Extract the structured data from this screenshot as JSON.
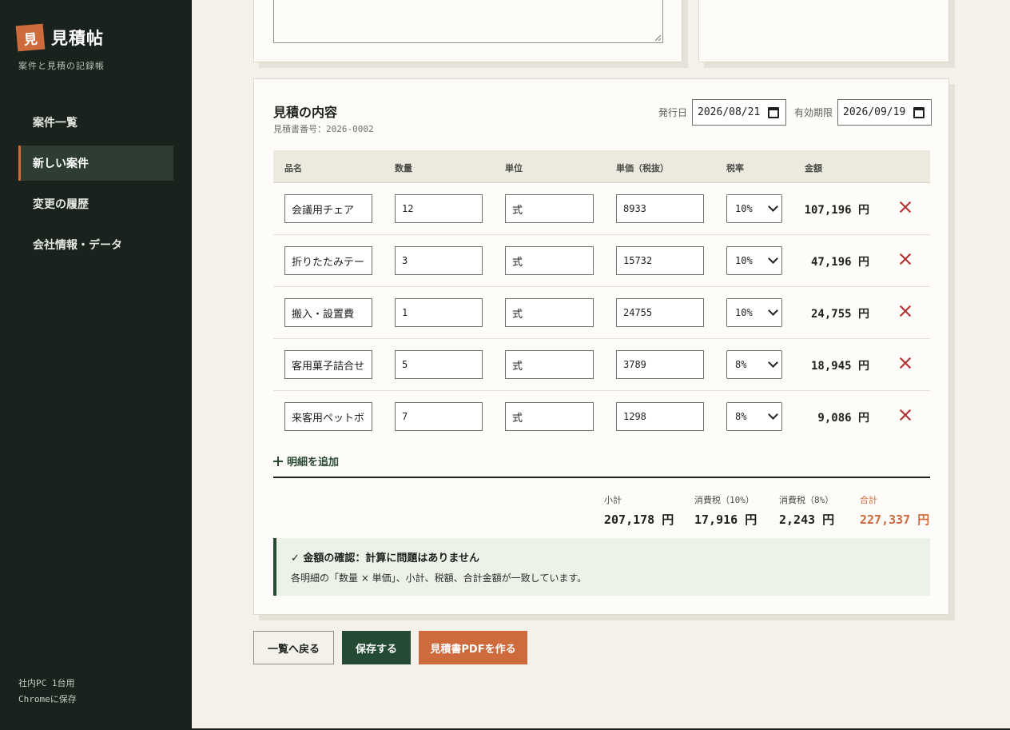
{
  "sidebar": {
    "logo_mark": "見",
    "app_name": "見積帖",
    "tagline": "案件と見積の記録帳",
    "items": [
      {
        "label": "案件一覧",
        "active": false
      },
      {
        "label": "新しい案件",
        "active": true
      },
      {
        "label": "変更の履歴",
        "active": false
      },
      {
        "label": "会社情報・データ",
        "active": false
      }
    ],
    "footer_line1": "社内PC 1台用",
    "footer_line2": "Chromeに保存"
  },
  "estimate": {
    "title": "見積の内容",
    "number_label": "見積書番号：2026-0002",
    "issue_label": "発行日",
    "issue_date": "2026/08/21",
    "expiry_label": "有効期限",
    "expiry_date": "2026/09/19",
    "columns": [
      "品名",
      "数量",
      "単位",
      "単価（税抜）",
      "税率",
      "金額"
    ],
    "rows": [
      {
        "item": "会議用チェア",
        "qty": "12",
        "unit": "式",
        "price": "8933",
        "tax": "10%",
        "amount": "107,196 円"
      },
      {
        "item": "折りたたみテー",
        "qty": "3",
        "unit": "式",
        "price": "15732",
        "tax": "10%",
        "amount": "47,196 円"
      },
      {
        "item": "搬入・設置費",
        "qty": "1",
        "unit": "式",
        "price": "24755",
        "tax": "10%",
        "amount": "24,755 円"
      },
      {
        "item": "客用菓子詰合せ",
        "qty": "5",
        "unit": "式",
        "price": "3789",
        "tax": "8%",
        "amount": "18,945 円"
      },
      {
        "item": "来客用ペットボ",
        "qty": "7",
        "unit": "式",
        "price": "1298",
        "tax": "8%",
        "amount": "9,086 円"
      }
    ],
    "add_line_label": "明細を追加",
    "totals": {
      "subtotal_label": "小計",
      "subtotal": "207,178 円",
      "tax10_label": "消費税（10%）",
      "tax10": "17,916 円",
      "tax8_label": "消費税（8%）",
      "tax8": "2,243 円",
      "grand_label": "合計",
      "grand": "227,337 円"
    },
    "check": {
      "title": "✓ 金額の確認：計算に問題はありません",
      "body": "各明細の「数量 × 単価」、小計、税額、合計金額が一致しています。"
    }
  },
  "actions": {
    "back": "一覧へ戻る",
    "save": "保存する",
    "pdf": "見積書PDFを作る"
  },
  "colors": {
    "accent": "#cf6a3c",
    "sidebar_bg": "#1a221d",
    "primary": "#244a33",
    "danger": "#b32d2d"
  }
}
